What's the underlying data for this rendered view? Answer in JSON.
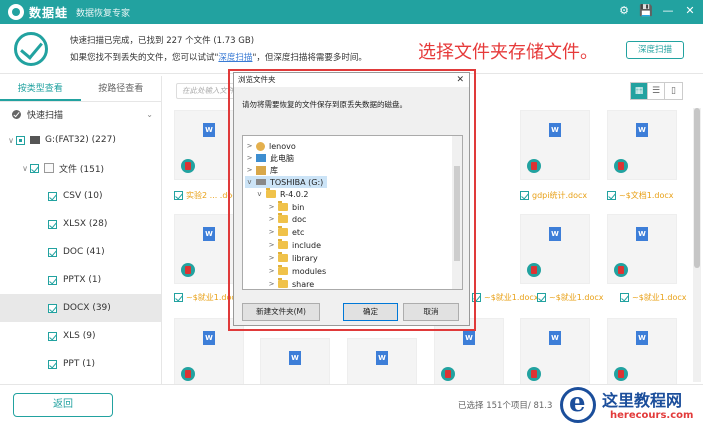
{
  "app": {
    "name": "数据蛙",
    "edition": "数据恢复专家",
    "window_controls": [
      "⚙",
      "💾",
      "—",
      "✕"
    ]
  },
  "status": {
    "line1": "快速扫描已完成，已找到 227 个文件 (1.73 GB)",
    "line2_prefix": "如果您找不到丢失的文件，您可以试试\"",
    "deep_link": "深度扫描",
    "line2_suffix": "\"，但深度扫描将需要多时间。",
    "annotation": "选择文件夹存储文件。",
    "deep_button": "深度扫描"
  },
  "left_tabs": [
    "按类型查看",
    "按路径查看"
  ],
  "tree": {
    "quick_scan": "快速扫描",
    "drive": "G:(FAT32) (227)",
    "documents": "文件 (151)",
    "types": [
      {
        "label": "CSV (10)",
        "selected": false
      },
      {
        "label": "XLSX (28)",
        "selected": false
      },
      {
        "label": "DOC (41)",
        "selected": false
      },
      {
        "label": "PPTX (1)",
        "selected": false
      },
      {
        "label": "DOCX (39)",
        "selected": true
      },
      {
        "label": "XLS (9)",
        "selected": false
      },
      {
        "label": "PPT (1)",
        "selected": false
      }
    ]
  },
  "search": {
    "placeholder": "在此处输入文件..."
  },
  "view_buttons": [
    "▦",
    "☰",
    "▯"
  ],
  "grid": {
    "doc_badge": "W",
    "row1_names": [
      "实验2 ... .docx",
      "",
      "",
      "",
      "gdpi统计.docx",
      "~$文档1.docx"
    ],
    "row2_names": [
      "~$就业1.docx",
      "~$就业1.docx",
      "~$就业1.docx",
      "~$就业1.docx",
      "~$就业1.docx",
      "~$就业1.docx"
    ]
  },
  "bottom": {
    "back": "返回",
    "selected": "已选择 151个项目/ 81.3"
  },
  "watermark": {
    "title": "这里教程网",
    "url": "herecours.com"
  },
  "dialog": {
    "title": "浏览文件夹",
    "close": "✕",
    "description": "请勿将需要恢复的文件保存到原丢失数据的磁盘。",
    "items": [
      {
        "label": "lenovo",
        "icon": "user",
        "level": 0,
        "arrow": ">"
      },
      {
        "label": "此电脑",
        "icon": "pc",
        "level": 0,
        "arrow": ">"
      },
      {
        "label": "库",
        "icon": "lib",
        "level": 0,
        "arrow": ">"
      },
      {
        "label": "TOSHIBA (G:)",
        "icon": "usb",
        "level": 0,
        "arrow": "v",
        "selected": true
      },
      {
        "label": "R-4.0.2",
        "icon": "folder",
        "level": 1,
        "arrow": "v"
      },
      {
        "label": "bin",
        "icon": "folder",
        "level": 2,
        "arrow": ">"
      },
      {
        "label": "doc",
        "icon": "folder",
        "level": 2,
        "arrow": ">"
      },
      {
        "label": "etc",
        "icon": "folder",
        "level": 2,
        "arrow": ">"
      },
      {
        "label": "include",
        "icon": "folder",
        "level": 2,
        "arrow": ">"
      },
      {
        "label": "library",
        "icon": "folder",
        "level": 2,
        "arrow": ">"
      },
      {
        "label": "modules",
        "icon": "folder",
        "level": 2,
        "arrow": ">"
      },
      {
        "label": "share",
        "icon": "folder",
        "level": 2,
        "arrow": ">"
      }
    ],
    "new_folder": "新建文件夹(M)",
    "ok": "确定",
    "cancel": "取消"
  }
}
